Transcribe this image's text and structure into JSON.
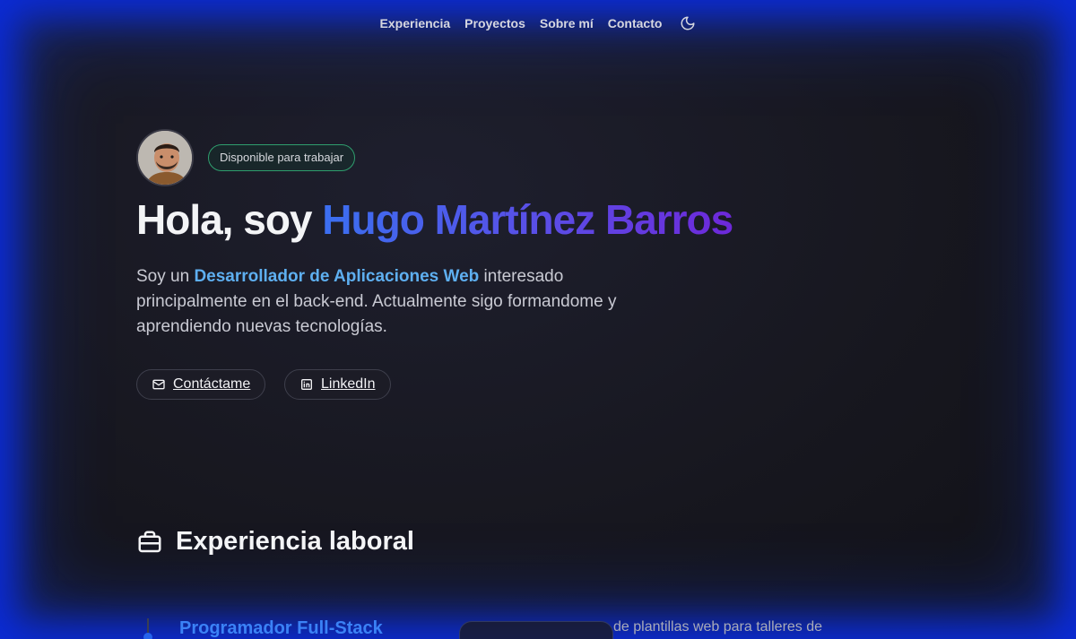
{
  "nav": {
    "items": [
      "Experiencia",
      "Proyectos",
      "Sobre mí",
      "Contacto"
    ],
    "theme_icon": "moon-icon"
  },
  "hero": {
    "badge": "Disponible para trabajar",
    "greeting": "Hola, soy ",
    "name": "Hugo Martínez Barros",
    "intro_pre": "Soy un ",
    "intro_highlight": "Desarrollador de Aplicaciones Web",
    "intro_post": " interesado principalmente en el back-end. Actualmente sigo formandome y aprendiendo nuevas tecnologías.",
    "buttons": {
      "contact": "Contáctame",
      "linkedin": "LinkedIn"
    }
  },
  "experience": {
    "title": "Experiencia laboral",
    "job_title": "Programador Full-Stack",
    "job_desc_fragment": "de plantillas web para talleres de"
  },
  "colors": {
    "accent_blue": "#3b82f6",
    "highlight": "#5eaff0",
    "badge_border": "#2f9e6e",
    "gradient_start": "#3b6ff0",
    "gradient_end": "#6d28d9"
  }
}
